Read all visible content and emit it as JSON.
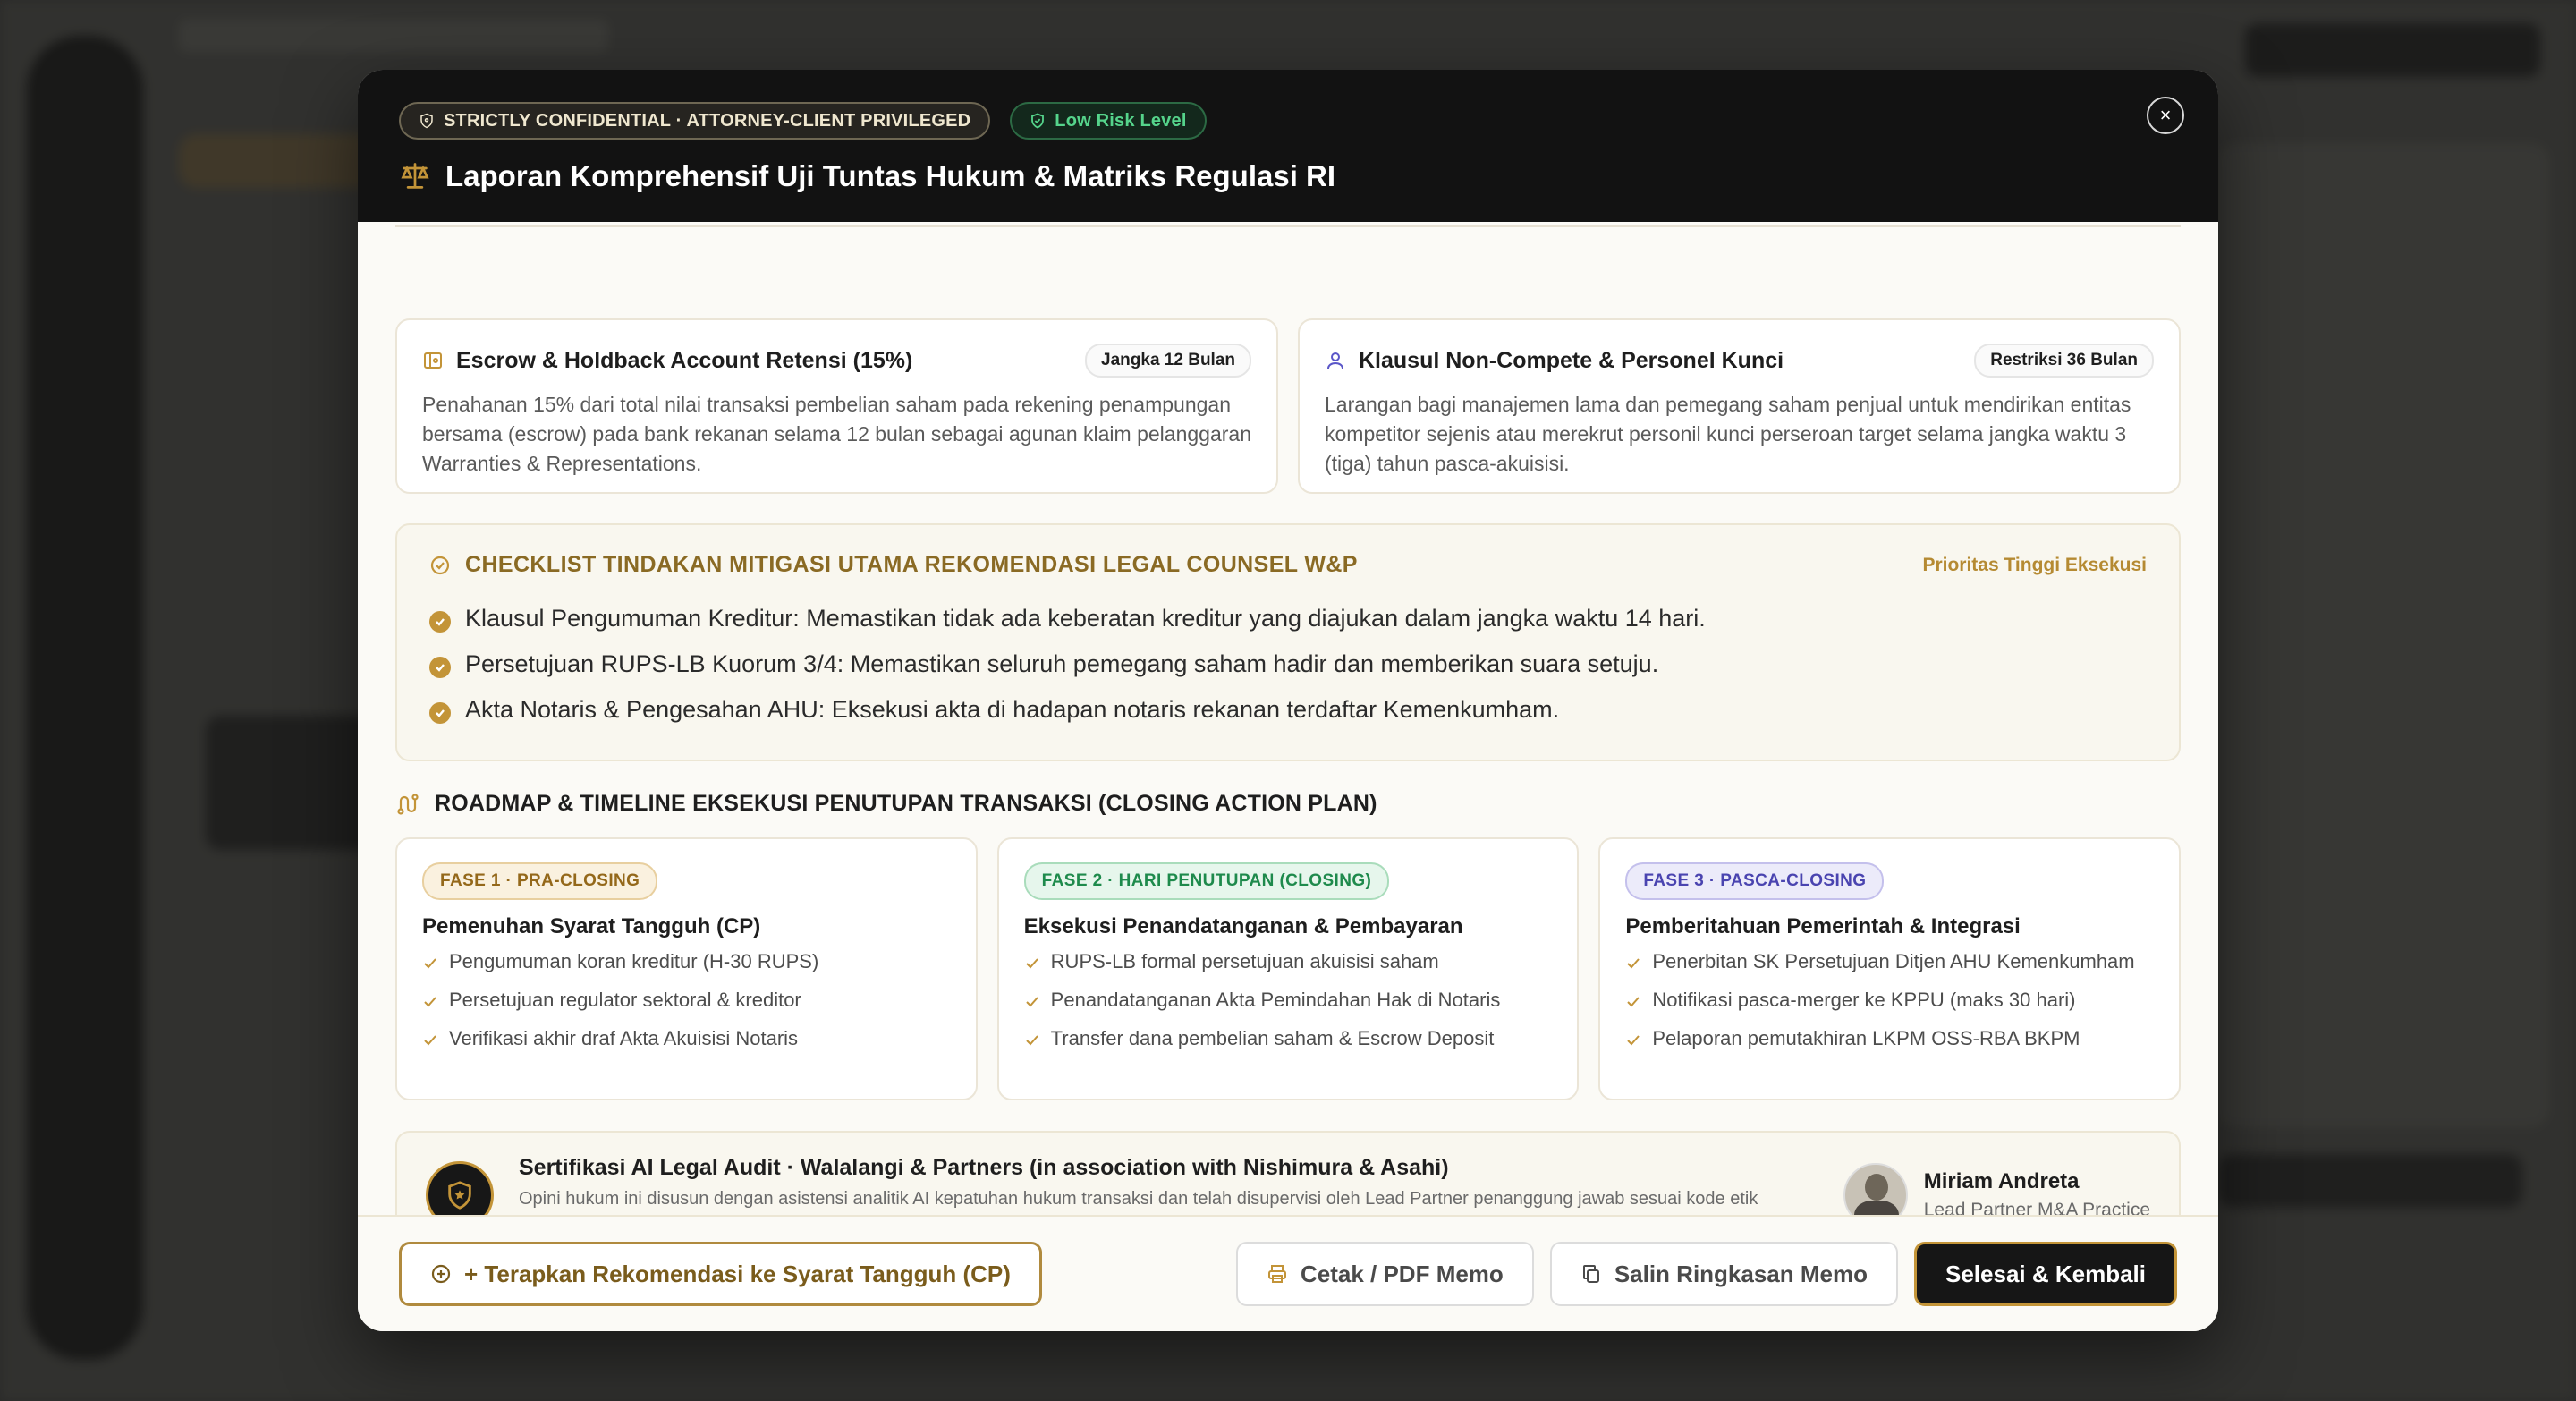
{
  "header": {
    "confidential_badge": "STRICTLY CONFIDENTIAL · ATTORNEY-CLIENT PRIVILEGED",
    "risk_badge": "Low Risk Level",
    "title": "Laporan Komprehensif Uji Tuntas Hukum & Matriks Regulasi RI",
    "close_label": "×"
  },
  "cards": [
    {
      "icon": "vault-icon",
      "title": "Escrow & Holdback Account Retensi (15%)",
      "chip": "Jangka 12 Bulan",
      "text": "Penahanan 15% dari total nilai transaksi pembelian saham pada rekening penampungan bersama (escrow) pada bank rekanan selama 12 bulan sebagai agunan klaim pelanggaran Warranties & Representations."
    },
    {
      "icon": "user-icon",
      "title": "Klausul Non-Compete & Personel Kunci",
      "chip": "Restriksi 36 Bulan",
      "text": "Larangan bagi manajemen lama dan pemegang saham penjual untuk mendirikan entitas kompetitor sejenis atau merekrut personil kunci perseroan target selama jangka waktu 3 (tiga) tahun pasca-akuisisi."
    }
  ],
  "checklist": {
    "title": "CHECKLIST TINDAKAN MITIGASI UTAMA REKOMENDASI LEGAL COUNSEL W&P",
    "priority": "Prioritas Tinggi Eksekusi",
    "items": [
      "Klausul Pengumuman Kreditur: Memastikan tidak ada keberatan kreditur yang diajukan dalam jangka waktu 14 hari.",
      "Persetujuan RUPS-LB Kuorum 3/4: Memastikan seluruh pemegang saham hadir dan memberikan suara setuju.",
      "Akta Notaris & Pengesahan AHU: Eksekusi akta di hadapan notaris rekanan terdaftar Kemenkumham."
    ]
  },
  "roadmap": {
    "title": "ROADMAP & TIMELINE EKSEKUSI PENUTUPAN TRANSAKSI (CLOSING ACTION PLAN)",
    "phases": [
      {
        "badge": "FASE 1 · PRA-CLOSING",
        "title": "Pemenuhan Syarat Tangguh (CP)",
        "items": [
          "Pengumuman koran kreditur (H-30 RUPS)",
          "Persetujuan regulator sektoral & kreditor",
          "Verifikasi akhir draf Akta Akuisisi Notaris"
        ]
      },
      {
        "badge": "FASE 2 · HARI PENUTUPAN (CLOSING)",
        "title": "Eksekusi Penandatanganan & Pembayaran",
        "items": [
          "RUPS-LB formal persetujuan akuisisi saham",
          "Penandatanganan Akta Pemindahan Hak di Notaris",
          "Transfer dana pembelian saham & Escrow Deposit"
        ]
      },
      {
        "badge": "FASE 3 · PASCA-CLOSING",
        "title": "Pemberitahuan Pemerintah & Integrasi",
        "items": [
          "Penerbitan SK Persetujuan Ditjen AHU Kemenkumham",
          "Notifikasi pasca-merger ke KPPU (maks 30 hari)",
          "Pelaporan pemutakhiran LKPM OSS-RBA BKPM"
        ]
      }
    ]
  },
  "certification": {
    "title": "Sertifikasi AI Legal Audit · Walalangi & Partners (in association with Nishimura & Asahi)",
    "desc": "Opini hukum ini disusun dengan asistensi analitik AI kepatuhan hukum transaksi dan telah disupervisi oleh Lead Partner penanggung jawab sesuai kode etik advokat PERADI & standar transaksi merger akuisisi internasional.",
    "partner_name": "Miriam Andreta",
    "partner_role": "Lead Partner M&A Practice"
  },
  "footer": {
    "apply_label": "+ Terapkan Rekomendasi ke Syarat Tangguh (CP)",
    "print_label": "Cetak / PDF Memo",
    "copy_label": "Salin Ringkasan Memo",
    "done_label": "Selesai & Kembali"
  },
  "colors": {
    "accent_gold": "#c39438",
    "risk_green": "#55d48b",
    "header_bg": "#121212"
  }
}
